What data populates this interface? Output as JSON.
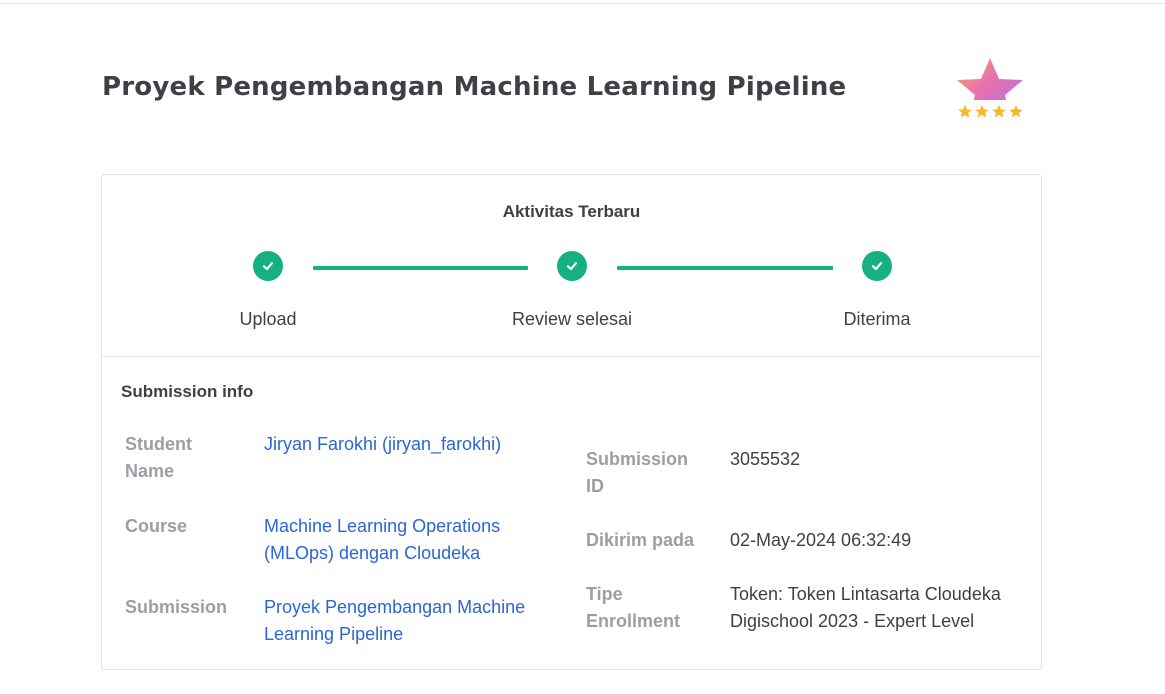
{
  "page": {
    "title": "Proyek Pengembangan Machine Learning Pipeline"
  },
  "badge": {
    "icon": "star-rating-badge-icon",
    "stars": 4
  },
  "activity": {
    "title": "Aktivitas Terbaru",
    "accent_color": "#17b083",
    "steps": [
      {
        "label": "Upload",
        "status": "done"
      },
      {
        "label": "Review selesai",
        "status": "done"
      },
      {
        "label": "Diterima",
        "status": "done"
      }
    ]
  },
  "submission_info": {
    "title": "Submission info",
    "student_name": {
      "label": "Student Name",
      "value": "Jiryan Farokhi (jiryan_farokhi)"
    },
    "course": {
      "label": "Course",
      "value": "Machine Learning Operations (MLOps) dengan Cloudeka"
    },
    "submission": {
      "label": "Submission",
      "value": "Proyek Pengembangan Machine Learning Pipeline"
    },
    "submission_id": {
      "label": "Submission ID",
      "value": "3055532"
    },
    "submitted_at": {
      "label": "Dikirim pada",
      "value": "02-May-2024 06:32:49"
    },
    "enrollment_type": {
      "label": "Tipe Enrollment",
      "value": "Token: Token Lintasarta Cloudeka Digischool 2023 - Expert Level"
    }
  },
  "colors": {
    "link": "#2a66d6",
    "label": "#9b9ea6",
    "text": "#3f3f46"
  }
}
